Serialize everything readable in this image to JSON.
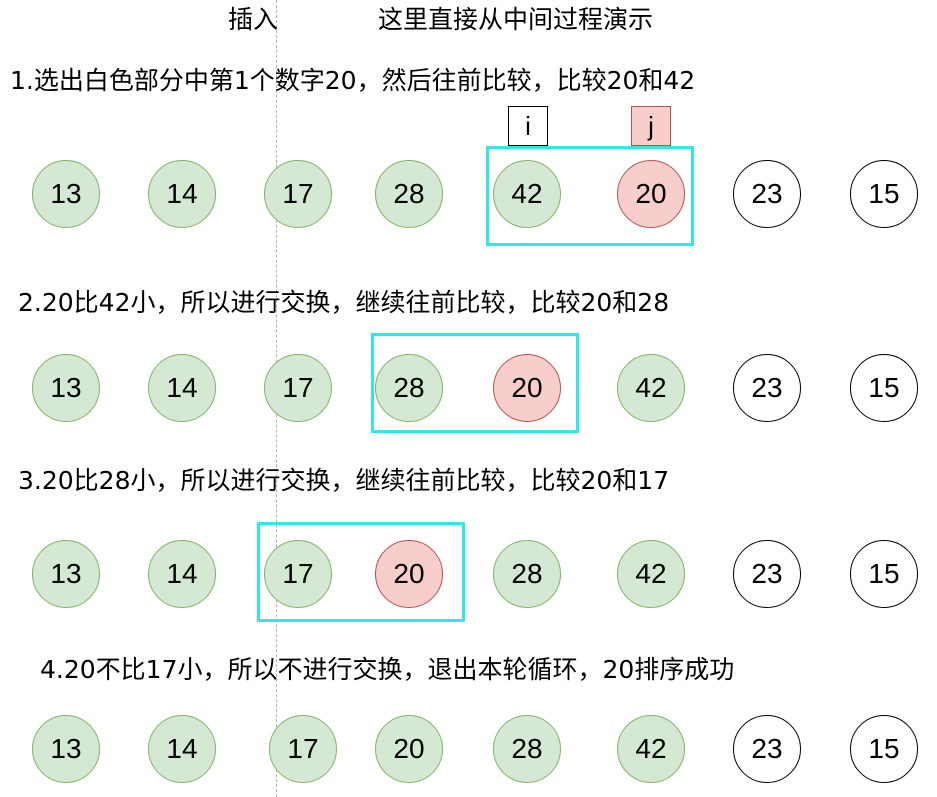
{
  "header": {
    "insert_label": "插入",
    "subtitle": "这里直接从中间过程演示"
  },
  "pointers": {
    "i": "i",
    "j": "j"
  },
  "steps": [
    {
      "caption": "1.选出白色部分中第1个数字20，然后往前比较，比较20和42",
      "nodes": [
        {
          "value": "13",
          "state": "sorted"
        },
        {
          "value": "14",
          "state": "sorted"
        },
        {
          "value": "17",
          "state": "sorted"
        },
        {
          "value": "28",
          "state": "sorted"
        },
        {
          "value": "42",
          "state": "sorted"
        },
        {
          "value": "20",
          "state": "key"
        },
        {
          "value": "23",
          "state": "unsorted"
        },
        {
          "value": "15",
          "state": "unsorted"
        }
      ]
    },
    {
      "caption": "2.20比42小，所以进行交换，继续往前比较，比较20和28",
      "nodes": [
        {
          "value": "13",
          "state": "sorted"
        },
        {
          "value": "14",
          "state": "sorted"
        },
        {
          "value": "17",
          "state": "sorted"
        },
        {
          "value": "28",
          "state": "sorted"
        },
        {
          "value": "20",
          "state": "key"
        },
        {
          "value": "42",
          "state": "sorted"
        },
        {
          "value": "23",
          "state": "unsorted"
        },
        {
          "value": "15",
          "state": "unsorted"
        }
      ]
    },
    {
      "caption": "3.20比28小，所以进行交换，继续往前比较，比较20和17",
      "nodes": [
        {
          "value": "13",
          "state": "sorted"
        },
        {
          "value": "14",
          "state": "sorted"
        },
        {
          "value": "17",
          "state": "sorted"
        },
        {
          "value": "20",
          "state": "key"
        },
        {
          "value": "28",
          "state": "sorted"
        },
        {
          "value": "42",
          "state": "sorted"
        },
        {
          "value": "23",
          "state": "unsorted"
        },
        {
          "value": "15",
          "state": "unsorted"
        }
      ]
    },
    {
      "caption": "4.20不比17小，所以不进行交换，退出本轮循环，20排序成功",
      "nodes": [
        {
          "value": "13",
          "state": "sorted"
        },
        {
          "value": "14",
          "state": "sorted"
        },
        {
          "value": "17",
          "state": "sorted"
        },
        {
          "value": "20",
          "state": "sorted"
        },
        {
          "value": "28",
          "state": "sorted"
        },
        {
          "value": "42",
          "state": "sorted"
        },
        {
          "value": "23",
          "state": "unsorted"
        },
        {
          "value": "15",
          "state": "unsorted"
        }
      ]
    }
  ]
}
